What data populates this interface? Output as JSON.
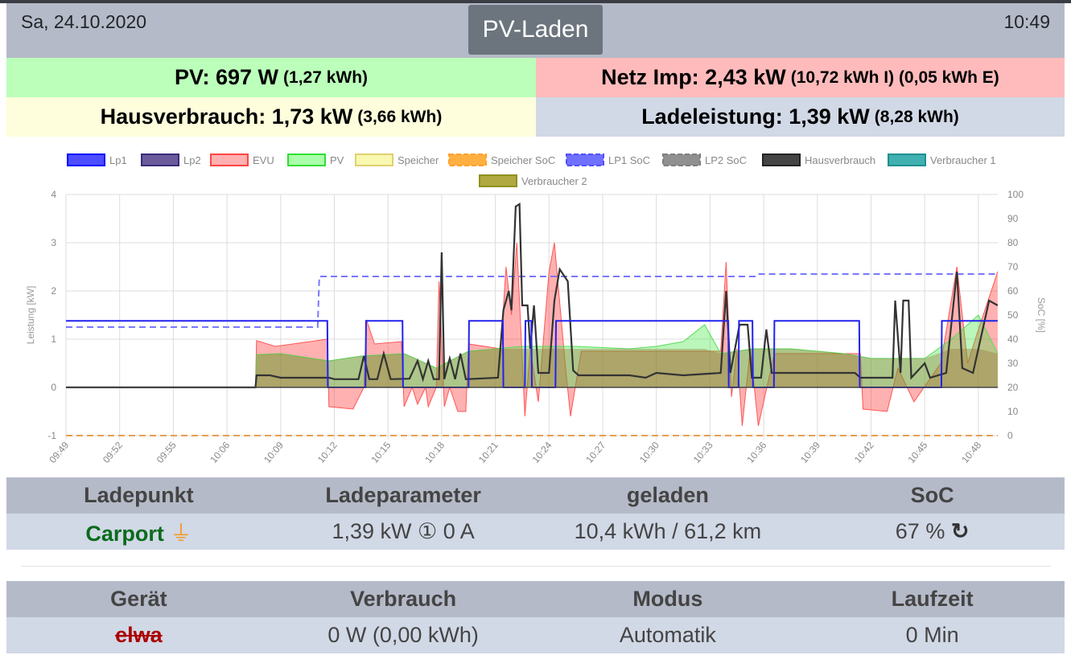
{
  "header": {
    "date": "Sa, 24.10.2020",
    "time": "10:49",
    "mode_button": "PV-Laden"
  },
  "summary": {
    "pv": {
      "label": "PV: 697 W",
      "sub": "(1,27 kWh)",
      "color": "#bbffbb"
    },
    "netz": {
      "label": "Netz Imp: 2,43 kW",
      "sub": "(10,72 kWh I) (0,05 kWh E)",
      "color": "#ffbbbb"
    },
    "haus": {
      "label": "Hausverbrauch: 1,73 kW",
      "sub": "(3,66 kWh)",
      "color": "#fefedc"
    },
    "lade": {
      "label": "Ladeleistung: 1,39 kW",
      "sub": "(8,28 kWh)",
      "color": "#d1d8e6"
    }
  },
  "chart_data": {
    "type": "line",
    "ylabel": "Leistung [kW]",
    "y2label": "SoC [%]",
    "ylim": [
      -1,
      4
    ],
    "y2lim": [
      0,
      100
    ],
    "yticks": [
      "4",
      "3",
      "2",
      "1",
      "0",
      "-1"
    ],
    "y2ticks": [
      "100",
      "90",
      "80",
      "70",
      "60",
      "50",
      "40",
      "30",
      "20",
      "10",
      "0"
    ],
    "xticks": [
      "09:49",
      "09:52",
      "09:55",
      "10:06",
      "10:09",
      "10:12",
      "10:15",
      "10:18",
      "10:21",
      "10:24",
      "10:27",
      "10:30",
      "10:33",
      "10:36",
      "10:39",
      "10:42",
      "10:45",
      "10:48"
    ],
    "legend": [
      {
        "name": "Lp1",
        "color": "#0000ff",
        "fill": "#4d4dff"
      },
      {
        "name": "Lp2",
        "color": "#3c2a7a",
        "fill": "#6a5a9a"
      },
      {
        "name": "EVU",
        "color": "#ff4444",
        "fill": "#ffb0b0"
      },
      {
        "name": "PV",
        "color": "#33dd33",
        "fill": "#aaffaa"
      },
      {
        "name": "Speicher",
        "color": "#e0d070",
        "fill": "#f8f8b0"
      },
      {
        "name": "Speicher SoC",
        "color": "#ffa030",
        "fill": "#ffb040",
        "dashed": true
      },
      {
        "name": "LP1 SoC",
        "color": "#5050ff",
        "fill": "#7070ff",
        "dashed": true
      },
      {
        "name": "LP2 SoC",
        "color": "#808080",
        "fill": "#909090",
        "dashed": true
      },
      {
        "name": "Hausverbrauch",
        "color": "#222222",
        "fill": "#444444"
      },
      {
        "name": "Verbraucher 1",
        "color": "#209090",
        "fill": "#40b0b0"
      },
      {
        "name": "Verbraucher 2",
        "color": "#909020",
        "fill": "#b0a840"
      }
    ],
    "series": {
      "EVU": [
        [
          0,
          0
        ],
        [
          3.53,
          0
        ],
        [
          3.55,
          0.97
        ],
        [
          3.9,
          0.85
        ],
        [
          4.87,
          1.0
        ],
        [
          4.9,
          -0.4
        ],
        [
          5.35,
          -0.45
        ],
        [
          5.55,
          0
        ],
        [
          5.6,
          1.4
        ],
        [
          5.75,
          0.9
        ],
        [
          6.25,
          0.95
        ],
        [
          6.3,
          -0.4
        ],
        [
          6.45,
          0
        ],
        [
          6.55,
          -0.35
        ],
        [
          6.7,
          0
        ],
        [
          6.75,
          -0.4
        ],
        [
          6.9,
          0
        ],
        [
          6.95,
          2.2
        ],
        [
          7.05,
          -0.4
        ],
        [
          7.15,
          0
        ],
        [
          7.3,
          -0.5
        ],
        [
          7.45,
          -0.5
        ],
        [
          7.5,
          0.9
        ],
        [
          8.1,
          0.8
        ],
        [
          8.2,
          2.5
        ],
        [
          8.3,
          1.5
        ],
        [
          8.4,
          3.0
        ],
        [
          8.55,
          -0.6
        ],
        [
          8.65,
          0.8
        ],
        [
          8.8,
          -0.3
        ],
        [
          9.0,
          2.4
        ],
        [
          9.1,
          3.0
        ],
        [
          9.3,
          0.5
        ],
        [
          9.4,
          -0.6
        ],
        [
          9.6,
          0.75
        ],
        [
          12.2,
          0.75
        ],
        [
          12.3,
          2.6
        ],
        [
          12.4,
          -0.2
        ],
        [
          12.5,
          0.8
        ],
        [
          12.6,
          -0.8
        ],
        [
          12.75,
          0.8
        ],
        [
          12.9,
          -0.8
        ],
        [
          13.2,
          0.7
        ],
        [
          14.8,
          0.7
        ],
        [
          14.85,
          -0.45
        ],
        [
          15.3,
          -0.5
        ],
        [
          15.5,
          0.4
        ],
        [
          15.8,
          -0.3
        ],
        [
          16.3,
          0.5
        ],
        [
          16.6,
          2.5
        ],
        [
          16.8,
          0.5
        ],
        [
          17.0,
          1.2
        ],
        [
          17.36,
          2.4
        ]
      ],
      "PV": [
        [
          0,
          0
        ],
        [
          3.53,
          0
        ],
        [
          3.55,
          0.68
        ],
        [
          4.0,
          0.7
        ],
        [
          4.9,
          0.55
        ],
        [
          5.5,
          0.65
        ],
        [
          6.3,
          0.7
        ],
        [
          6.9,
          0.4
        ],
        [
          7.5,
          0.75
        ],
        [
          8.0,
          0.8
        ],
        [
          8.5,
          0.85
        ],
        [
          9.5,
          0.85
        ],
        [
          10.5,
          0.8
        ],
        [
          11.0,
          0.85
        ],
        [
          11.5,
          0.95
        ],
        [
          11.9,
          1.3
        ],
        [
          12.2,
          0.7
        ],
        [
          12.8,
          0.8
        ],
        [
          13.5,
          0.8
        ],
        [
          14.5,
          0.7
        ],
        [
          15.0,
          0.6
        ],
        [
          16.0,
          0.6
        ],
        [
          16.5,
          1.0
        ],
        [
          17.0,
          1.5
        ],
        [
          17.36,
          0.7
        ]
      ],
      "Lp1": [
        [
          0,
          1.38
        ],
        [
          4.87,
          1.38
        ],
        [
          4.88,
          0
        ],
        [
          5.58,
          0
        ],
        [
          5.59,
          1.38
        ],
        [
          6.27,
          1.38
        ],
        [
          6.28,
          0
        ],
        [
          7.5,
          0
        ],
        [
          7.51,
          1.38
        ],
        [
          8.14,
          1.38
        ],
        [
          8.15,
          0
        ],
        [
          8.55,
          0
        ],
        [
          8.56,
          1.38
        ],
        [
          8.67,
          1.38
        ],
        [
          8.68,
          0
        ],
        [
          9.12,
          0
        ],
        [
          9.13,
          1.38
        ],
        [
          12.34,
          1.38
        ],
        [
          12.35,
          0
        ],
        [
          12.53,
          0
        ],
        [
          12.54,
          1.38
        ],
        [
          12.79,
          1.38
        ],
        [
          12.8,
          0
        ],
        [
          13.19,
          0
        ],
        [
          13.2,
          1.38
        ],
        [
          14.78,
          1.38
        ],
        [
          14.79,
          0
        ],
        [
          16.31,
          0
        ],
        [
          16.32,
          1.38
        ],
        [
          17.36,
          1.38
        ]
      ],
      "Hausverbrauch": [
        [
          0,
          0
        ],
        [
          3.53,
          0
        ],
        [
          3.55,
          0.25
        ],
        [
          3.8,
          0.25
        ],
        [
          4.0,
          0.2
        ],
        [
          4.9,
          0.2
        ],
        [
          5.0,
          0.17
        ],
        [
          5.45,
          0.17
        ],
        [
          5.55,
          0.65
        ],
        [
          5.65,
          0.17
        ],
        [
          5.8,
          0.17
        ],
        [
          5.92,
          0.7
        ],
        [
          6.05,
          0.17
        ],
        [
          6.4,
          0.18
        ],
        [
          6.55,
          0.55
        ],
        [
          6.65,
          0.17
        ],
        [
          6.75,
          0.55
        ],
        [
          6.85,
          0.17
        ],
        [
          6.95,
          0.17
        ],
        [
          7.0,
          2.8
        ],
        [
          7.05,
          0.17
        ],
        [
          7.15,
          0.6
        ],
        [
          7.25,
          0.17
        ],
        [
          7.35,
          0.7
        ],
        [
          7.45,
          0.17
        ],
        [
          8.05,
          0.2
        ],
        [
          8.15,
          1.6
        ],
        [
          8.25,
          2.0
        ],
        [
          8.3,
          1.6
        ],
        [
          8.38,
          3.75
        ],
        [
          8.45,
          3.8
        ],
        [
          8.5,
          1.7
        ],
        [
          8.6,
          1.7
        ],
        [
          8.65,
          0.8
        ],
        [
          8.72,
          1.7
        ],
        [
          8.8,
          0.3
        ],
        [
          9.0,
          0.3
        ],
        [
          9.1,
          1.8
        ],
        [
          9.2,
          2.45
        ],
        [
          9.35,
          2.2
        ],
        [
          9.45,
          0.35
        ],
        [
          9.55,
          0.25
        ],
        [
          10.5,
          0.25
        ],
        [
          10.8,
          0.2
        ],
        [
          11.0,
          0.3
        ],
        [
          11.5,
          0.25
        ],
        [
          12.2,
          0.3
        ],
        [
          12.3,
          2.0
        ],
        [
          12.38,
          0.3
        ],
        [
          12.55,
          1.3
        ],
        [
          12.7,
          1.3
        ],
        [
          12.78,
          0.2
        ],
        [
          12.95,
          0.2
        ],
        [
          13.05,
          1.2
        ],
        [
          13.15,
          0.3
        ],
        [
          14.7,
          0.3
        ],
        [
          14.8,
          0.2
        ],
        [
          15.4,
          0.2
        ],
        [
          15.45,
          1.8
        ],
        [
          15.55,
          0.3
        ],
        [
          15.6,
          1.8
        ],
        [
          15.7,
          1.8
        ],
        [
          15.75,
          0.2
        ],
        [
          16.0,
          0.5
        ],
        [
          16.1,
          0.2
        ],
        [
          16.4,
          0.3
        ],
        [
          16.6,
          2.4
        ],
        [
          16.7,
          0.4
        ],
        [
          16.9,
          0.3
        ],
        [
          17.1,
          1.3
        ],
        [
          17.2,
          1.8
        ],
        [
          17.36,
          1.7
        ]
      ],
      "LP1 SoC": [
        [
          0,
          45
        ],
        [
          4.69,
          45
        ],
        [
          4.72,
          66
        ],
        [
          12.86,
          66
        ],
        [
          12.9,
          67
        ],
        [
          17.36,
          67
        ]
      ],
      "Speicher SoC": [
        [
          0,
          0
        ],
        [
          17.36,
          0
        ]
      ]
    }
  },
  "ladepunkt": {
    "headers": [
      "Ladepunkt",
      "Ladeparameter",
      "geladen",
      "SoC"
    ],
    "row": {
      "name": "Carport",
      "params": "1,39 kW ① 0 A",
      "charged": "10,4 kWh / 61,2 km",
      "soc": "67 %"
    }
  },
  "geraete": {
    "headers": [
      "Gerät",
      "Verbrauch",
      "Modus",
      "Laufzeit"
    ],
    "row": {
      "name": "elwa",
      "usage": "0 W (0,00 kWh)",
      "mode": "Automatik",
      "runtime": "0 Min"
    }
  }
}
